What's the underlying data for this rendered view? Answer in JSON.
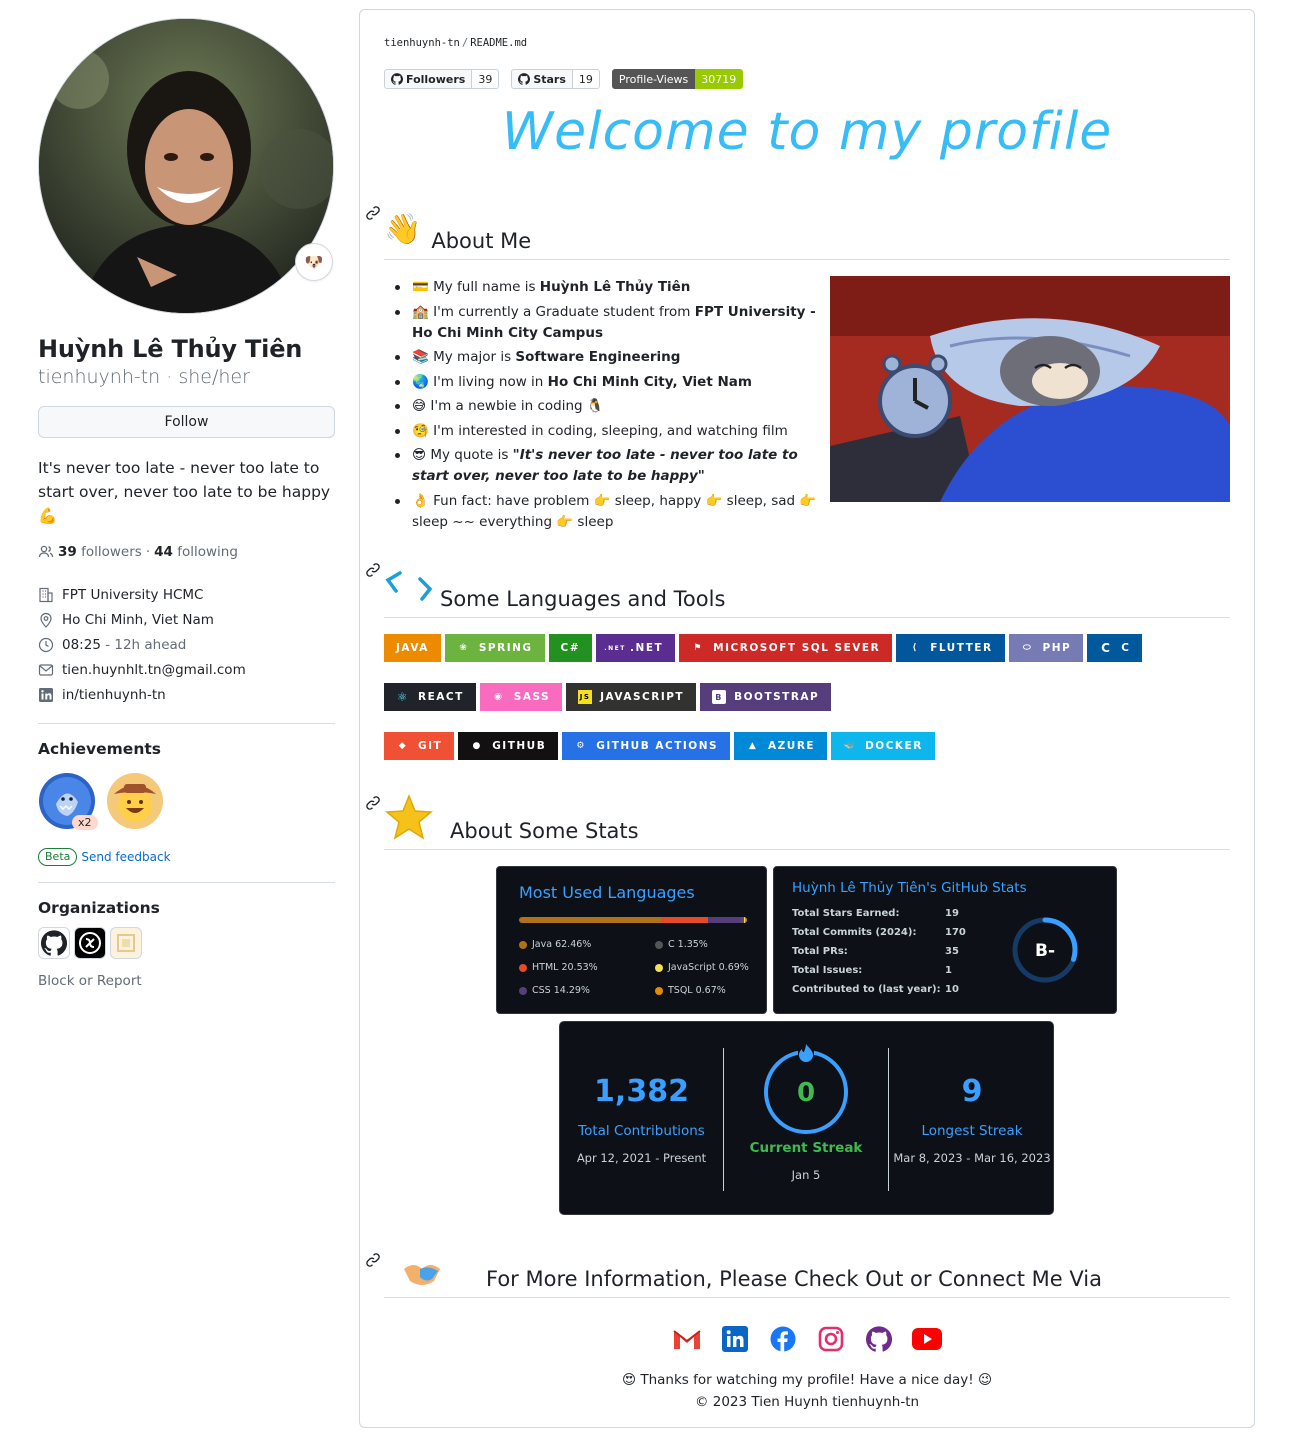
{
  "profile": {
    "full_name": "Huỳnh Lê Thủy Tiên",
    "handle": "tienhuynh-tn",
    "pronouns": "she/her",
    "status_emoji": "🐶",
    "follow_label": "Follow",
    "bio": "It's never too late - never too late to start over, never too late to be happy 💪",
    "followers_count": "39",
    "followers_label": "followers",
    "following_count": "44",
    "following_label": "following",
    "organization": "FPT University HCMC",
    "location": "Ho Chi Minh, Viet Nam",
    "local_time": "08:25",
    "time_offset": "- 12h ahead",
    "email": "tien.huynhlt.tn@gmail.com",
    "linkedin": "in/tienhuynh-tn"
  },
  "achievements": {
    "heading": "Achievements",
    "multiplier": "x2",
    "beta_label": "Beta",
    "feedback_label": "Send feedback"
  },
  "organizations": {
    "heading": "Organizations",
    "block_label": "Block or Report"
  },
  "readme": {
    "repo": "tienhuynh-tn",
    "separator": "/",
    "file": "README.md",
    "shields": [
      {
        "label": "Followers",
        "value": "39"
      },
      {
        "label": "Stars",
        "value": "19"
      },
      {
        "label": "Profile-Views",
        "value": "30719"
      }
    ],
    "welcome": "Welcome to my profile",
    "about_heading": "About Me",
    "about_emoji": "👋",
    "languages_heading": "Some Languages and Tools",
    "stats_heading": "About Some Stats",
    "connect_heading": "For More Information, Please Check Out or Connect Me Via",
    "thanks": "😍 Thanks for watching my profile! Have a nice day! 😉",
    "copyright": "© 2023 Tien Huynh tienhuynh-tn"
  },
  "about_items": [
    {
      "emoji": "💳",
      "pre": "My full name is ",
      "bold": "Huỳnh Lê Thủy Tiên",
      "post": ""
    },
    {
      "emoji": "🏫",
      "pre": "I'm currently a Graduate student from ",
      "bold": "FPT University - Ho Chi Minh City Campus",
      "post": ""
    },
    {
      "emoji": "📚",
      "pre": "My major is ",
      "bold": "Software Engineering",
      "post": ""
    },
    {
      "emoji": "🌏",
      "pre": "I'm living now in ",
      "bold": "Ho Chi Minh City, Viet Nam",
      "post": ""
    },
    {
      "emoji": "😅",
      "pre": "I'm a newbie in coding ",
      "bold": "",
      "post": "🐧"
    },
    {
      "emoji": "🧐",
      "pre": "I'm interested in coding, sleeping, and watching film",
      "bold": "",
      "post": ""
    },
    {
      "emoji": "😎",
      "pre": "My quote is ",
      "bold": "\"It's never too late - never too late to start over, never too late to be happy\"",
      "post": ""
    },
    {
      "emoji": "👌",
      "pre": "Fun fact: have problem 👉 sleep, happy 👉 sleep, sad 👉 sleep ~~ everything 👉 sleep",
      "bold": "",
      "post": ""
    }
  ],
  "tech_badges": {
    "row1": [
      {
        "name": "JAVA",
        "color": "#ED8B00",
        "icon": "☕"
      },
      {
        "name": "SPRING",
        "color": "#6DB33F",
        "icon": "❀"
      },
      {
        "name": "C#",
        "color": "#239120",
        "icon": ""
      },
      {
        "name": ".NET",
        "color": "#5C2D91",
        "icon": ".NET"
      },
      {
        "name": "MICROSOFT SQL SEVER",
        "color": "#CC2927",
        "icon": "⚑"
      },
      {
        "name": "FLUTTER",
        "color": "#02569B",
        "icon": "⟨"
      },
      {
        "name": "PHP",
        "color": "#777BB4",
        "icon": "⬭"
      },
      {
        "name": "C",
        "color": "#00599C",
        "icon": "C"
      }
    ],
    "row2": [
      {
        "name": "REACT",
        "color": "#20232A",
        "icon": "⚛"
      },
      {
        "name": "SASS",
        "color": "#F86BBF",
        "icon": "◉"
      },
      {
        "name": "JAVASCRIPT",
        "color": "#323330",
        "icon": "JS"
      },
      {
        "name": "BOOTSTRAP",
        "color": "#563D7C",
        "icon": "B"
      }
    ],
    "row3": [
      {
        "name": "GIT",
        "color": "#F05033",
        "icon": "◆"
      },
      {
        "name": "GITHUB",
        "color": "#121011",
        "icon": "●"
      },
      {
        "name": "GITHUB ACTIONS",
        "color": "#2671E5",
        "icon": "⚙"
      },
      {
        "name": "AZURE",
        "color": "#0089D6",
        "icon": "▲"
      },
      {
        "name": "DOCKER",
        "color": "#0DB7ED",
        "icon": "🐳"
      }
    ]
  },
  "languages_card": {
    "title": "Most Used Languages",
    "items": [
      {
        "name": "Java 62.46%",
        "pct": 62.46,
        "color": "#b07219"
      },
      {
        "name": "C 1.35%",
        "pct": 1.35,
        "color": "#555555"
      },
      {
        "name": "HTML 20.53%",
        "pct": 20.53,
        "color": "#e34c26"
      },
      {
        "name": "JavaScript 0.69%",
        "pct": 0.69,
        "color": "#f1e05a"
      },
      {
        "name": "CSS 14.29%",
        "pct": 14.29,
        "color": "#563d7c"
      },
      {
        "name": "TSQL 0.67%",
        "pct": 0.67,
        "color": "#e38c00"
      }
    ]
  },
  "stats_card": {
    "title": "Huỳnh Lê Thủy Tiên's GitHub Stats",
    "rank": "B-",
    "rank_progress": 0.3,
    "rows": [
      {
        "label": "Total Stars Earned:",
        "value": "19"
      },
      {
        "label": "Total Commits (2024):",
        "value": "170"
      },
      {
        "label": "Total PRs:",
        "value": "35"
      },
      {
        "label": "Total Issues:",
        "value": "1"
      },
      {
        "label": "Contributed to (last year):",
        "value": "10"
      }
    ]
  },
  "streak_card": {
    "total": "1,382",
    "total_label": "Total Contributions",
    "total_range": "Apr 12, 2021 - Present",
    "current": "0",
    "current_label": "Current Streak",
    "current_date": "Jan 5",
    "longest": "9",
    "longest_label": "Longest Streak",
    "longest_range": "Mar 8, 2023 - Mar 16, 2023"
  },
  "social": [
    "gmail-icon",
    "linkedin-icon",
    "facebook-icon",
    "instagram-icon",
    "github-icon",
    "youtube-icon"
  ],
  "colors": {
    "accent": "#36bcf7",
    "link": "#0969da",
    "stat_blue": "#3aa0ff"
  }
}
